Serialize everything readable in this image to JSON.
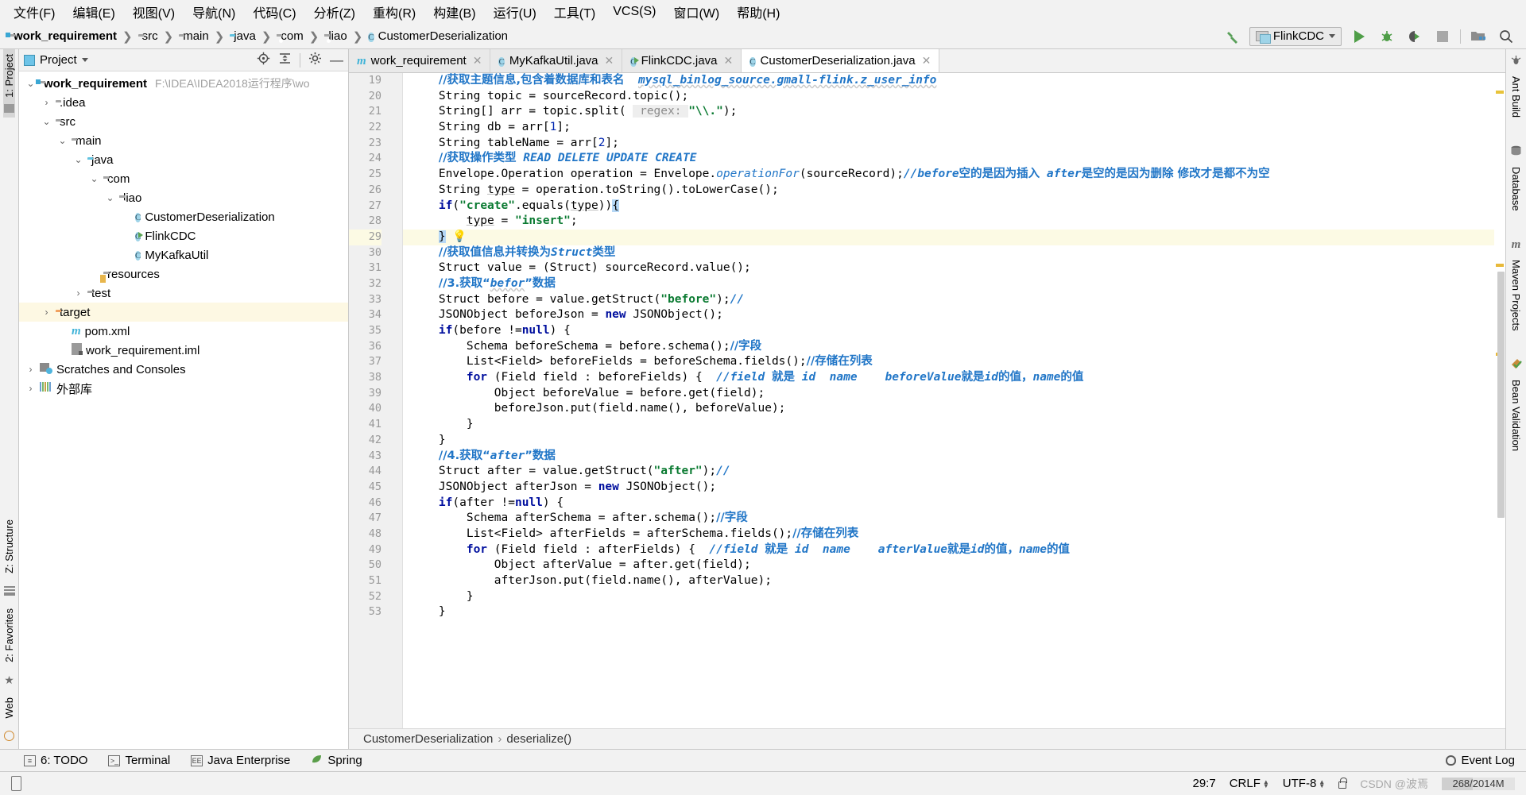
{
  "menubar": [
    {
      "label": "文件(F)"
    },
    {
      "label": "编辑(E)"
    },
    {
      "label": "视图(V)"
    },
    {
      "label": "导航(N)"
    },
    {
      "label": "代码(C)"
    },
    {
      "label": "分析(Z)"
    },
    {
      "label": "重构(R)"
    },
    {
      "label": "构建(B)"
    },
    {
      "label": "运行(U)"
    },
    {
      "label": "工具(T)"
    },
    {
      "label": "VCS(S)"
    },
    {
      "label": "窗口(W)"
    },
    {
      "label": "帮助(H)"
    }
  ],
  "breadcrumb": [
    {
      "label": "work_requirement",
      "icon": "module-folder-icon"
    },
    {
      "label": "src",
      "icon": "folder-icon"
    },
    {
      "label": "main",
      "icon": "folder-icon"
    },
    {
      "label": "java",
      "icon": "source-folder-icon"
    },
    {
      "label": "com",
      "icon": "package-icon"
    },
    {
      "label": "liao",
      "icon": "package-icon"
    },
    {
      "label": "CustomerDeserialization",
      "icon": "class-icon"
    }
  ],
  "toolbar": {
    "build_label": "build-hammer",
    "run_config": "FlinkCDC",
    "run_label": "run",
    "debug_label": "debug",
    "coverage_label": "run-with-coverage",
    "stop_label": "stop",
    "structure_label": "project-structure",
    "search_label": "search-everywhere"
  },
  "left_rail": {
    "top": "1: Project",
    "bottom": [
      "Z: Structure",
      "2: Favorites",
      "Web"
    ]
  },
  "right_rail": [
    "Ant Build",
    "Database",
    "Maven Projects",
    "Bean Validation"
  ],
  "project_panel": {
    "title": "Project",
    "tree": [
      {
        "indent": 0,
        "arrow": "v",
        "icon": "module-folder-icon",
        "label": "work_requirement",
        "bold": true,
        "path": "F:\\IDEA\\IDEA2018运行程序\\wo",
        "selected": false
      },
      {
        "indent": 1,
        "arrow": ">",
        "icon": "folder-icon",
        "label": ".idea",
        "bold": false,
        "path": "",
        "selected": false
      },
      {
        "indent": 1,
        "arrow": "v",
        "icon": "folder-icon",
        "label": "src",
        "bold": false,
        "path": "",
        "selected": false
      },
      {
        "indent": 2,
        "arrow": "v",
        "icon": "folder-icon",
        "label": "main",
        "bold": false,
        "path": "",
        "selected": false
      },
      {
        "indent": 3,
        "arrow": "v",
        "icon": "source-folder-icon",
        "label": "java",
        "bold": false,
        "path": "",
        "selected": false
      },
      {
        "indent": 4,
        "arrow": "v",
        "icon": "package-icon",
        "label": "com",
        "bold": false,
        "path": "",
        "selected": false
      },
      {
        "indent": 5,
        "arrow": "v",
        "icon": "package-icon",
        "label": "liao",
        "bold": false,
        "path": "",
        "selected": false
      },
      {
        "indent": 6,
        "arrow": "",
        "icon": "class-icon",
        "label": "CustomerDeserialization",
        "bold": false,
        "path": "",
        "selected": false
      },
      {
        "indent": 6,
        "arrow": "",
        "icon": "runnable-class-icon",
        "label": "FlinkCDC",
        "bold": false,
        "path": "",
        "selected": false
      },
      {
        "indent": 6,
        "arrow": "",
        "icon": "class-icon",
        "label": "MyKafkaUtil",
        "bold": false,
        "path": "",
        "selected": false
      },
      {
        "indent": 4,
        "arrow": "",
        "icon": "resources-folder-icon",
        "label": "resources",
        "bold": false,
        "path": "",
        "selected": false
      },
      {
        "indent": 3,
        "arrow": ">",
        "icon": "folder-icon",
        "label": "test",
        "bold": false,
        "path": "",
        "selected": false
      },
      {
        "indent": 1,
        "arrow": ">",
        "icon": "target-folder-icon",
        "label": "target",
        "bold": false,
        "path": "",
        "selected": true
      },
      {
        "indent": 2,
        "arrow": "",
        "icon": "maven-icon",
        "label": "pom.xml",
        "bold": false,
        "path": "",
        "selected": false
      },
      {
        "indent": 2,
        "arrow": "",
        "icon": "iml-icon",
        "label": "work_requirement.iml",
        "bold": false,
        "path": "",
        "selected": false
      },
      {
        "indent": 0,
        "arrow": ">",
        "icon": "scratches-icon",
        "label": "Scratches and Consoles",
        "bold": false,
        "path": "",
        "selected": false
      },
      {
        "indent": 0,
        "arrow": ">",
        "icon": "external-libraries-icon",
        "label": "外部库",
        "bold": false,
        "path": "",
        "selected": false
      }
    ]
  },
  "tabs": [
    {
      "label": "work_requirement",
      "icon": "maven-icon",
      "active": false
    },
    {
      "label": "MyKafkaUtil.java",
      "icon": "class-icon",
      "active": false
    },
    {
      "label": "FlinkCDC.java",
      "icon": "runnable-class-icon",
      "active": false
    },
    {
      "label": "CustomerDeserialization.java",
      "icon": "class-icon",
      "active": true
    }
  ],
  "editor": {
    "first_line": 19,
    "lines": [
      {
        "n": 19,
        "html": "    <span class='cmz'>//获取主题信息,包含着数据库和表名</span>  <span class='cm wavy'>mysql_binlog_source.gmall-flink.z_user_info</span>"
      },
      {
        "n": 20,
        "html": "    String topic = sourceRecord.topic();"
      },
      {
        "n": 21,
        "html": "    String[] arr = topic.split( <span class='hint'> regex: </span><span class='str'>\"\\\\.\"</span>);"
      },
      {
        "n": 22,
        "html": "    String db = arr[<span class='num'>1</span>];"
      },
      {
        "n": 23,
        "html": "    String tableName = arr[<span class='num'>2</span>];"
      },
      {
        "n": 24,
        "html": "    <span class='cmz'>//获取操作类型</span> <span class='cm'>READ DELETE UPDATE CREATE</span>"
      },
      {
        "n": 25,
        "html": "    Envelope.Operation operation = Envelope.<span class='cm' style='font-weight:normal'>operationFor</span>(sourceRecord);<span class='cm'>//before</span><span class='cmz'>空的是因为插入</span> <span class='cm'>after</span><span class='cmz'>是空的是因为删除 修改才是都不为空</span>"
      },
      {
        "n": 26,
        "html": "    String <span class='ul'>type</span> = operation.toString().toLowerCase();"
      },
      {
        "n": 27,
        "html": "    <span class='kw'>if</span>(<span class='str'>\"create\"</span>.equals(<span class='ul'>type</span>))<span class='brkt'>{</span>"
      },
      {
        "n": 28,
        "html": "        <span class='ul'>type</span> = <span class='str'>\"insert\"</span>;"
      },
      {
        "n": 29,
        "html": "    <span class='brkt'>}</span>",
        "highlight": true,
        "bulb": true
      },
      {
        "n": 30,
        "html": "    <span class='cmz'>//获取值信息并转换为</span><span class='cm'>Struct</span><span class='cmz'>类型</span>"
      },
      {
        "n": 31,
        "html": "    Struct value = (Struct) sourceRecord.value();"
      },
      {
        "n": 32,
        "html": "    <span class='cmz'>//3.获取“</span><span class='cm wavy'>befor</span><span class='cmz'>”数据</span>"
      },
      {
        "n": 33,
        "html": "    Struct before = value.getStruct(<span class='str'>\"before\"</span>);<span class='cm'>//</span>"
      },
      {
        "n": 34,
        "html": "    JSONObject beforeJson = <span class='kw'>new</span> JSONObject();"
      },
      {
        "n": 35,
        "html": "    <span class='kw'>if</span>(before !=<span class='kw'>null</span>) {"
      },
      {
        "n": 36,
        "html": "        Schema beforeSchema = before.schema();<span class='cmz'>//字段</span>"
      },
      {
        "n": 37,
        "html": "        List&lt;Field&gt; beforeFields = beforeSchema.fields();<span class='cmz'>//存储在列表</span>"
      },
      {
        "n": 38,
        "html": "        <span class='kw'>for</span> (Field field : beforeFields) {  <span class='cm'>//field </span><span class='cmz'>就是</span><span class='cm'> id  name    beforeValue</span><span class='cmz'>就是</span><span class='cm'>id</span><span class='cmz'>的值，</span><span class='cm'>name</span><span class='cmz'>的值</span>"
      },
      {
        "n": 39,
        "html": "            Object beforeValue = before.get(field);"
      },
      {
        "n": 40,
        "html": "            beforeJson.put(field.name(), beforeValue);"
      },
      {
        "n": 41,
        "html": "        }"
      },
      {
        "n": 42,
        "html": "    }"
      },
      {
        "n": 43,
        "html": "    <span class='cmz'>//4.获取“</span><span class='cm'>after</span><span class='cmz'>”数据</span>"
      },
      {
        "n": 44,
        "html": "    Struct after = value.getStruct(<span class='str'>\"after\"</span>);<span class='cm'>//</span>"
      },
      {
        "n": 45,
        "html": "    JSONObject afterJson = <span class='kw'>new</span> JSONObject();"
      },
      {
        "n": 46,
        "html": "    <span class='kw'>if</span>(after !=<span class='kw'>null</span>) {"
      },
      {
        "n": 47,
        "html": "        Schema afterSchema = after.schema();<span class='cmz'>//字段</span>"
      },
      {
        "n": 48,
        "html": "        List&lt;Field&gt; afterFields = afterSchema.fields();<span class='cmz'>//存储在列表</span>"
      },
      {
        "n": 49,
        "html": "        <span class='kw'>for</span> (Field field : afterFields) {  <span class='cm'>//field </span><span class='cmz'>就是</span><span class='cm'> id  name    afterValue</span><span class='cmz'>就是</span><span class='cm'>id</span><span class='cmz'>的值，</span><span class='cm'>name</span><span class='cmz'>的值</span>"
      },
      {
        "n": 50,
        "html": "            Object afterValue = after.get(field);"
      },
      {
        "n": 51,
        "html": "            afterJson.put(field.name(), afterValue);"
      },
      {
        "n": 52,
        "html": "        }"
      },
      {
        "n": 53,
        "html": "    }"
      }
    ]
  },
  "bottom_breadcrumb": {
    "class": "CustomerDeserialization",
    "method": "deserialize()"
  },
  "toolwindow_bar": [
    {
      "label": "6: TODO",
      "icon": "todo-icon"
    },
    {
      "label": "Terminal",
      "icon": "terminal-icon"
    },
    {
      "label": "Java Enterprise",
      "icon": "java-enterprise-icon"
    },
    {
      "label": "Spring",
      "icon": "spring-leaf-icon"
    }
  ],
  "event_log": "Event Log",
  "statusbar": {
    "caret": "29:7",
    "line_sep": "CRLF",
    "encoding": "UTF-8",
    "lock": "read-only-toggle",
    "memory": "268/2014M",
    "watermark": "CSDN @波焉"
  },
  "colors": {
    "accent_blue": "#2176c7",
    "keyword_blue": "#000f9e",
    "string_green": "#0a7a31",
    "selection": "#c5dffb",
    "highlight_row": "#fcfae4",
    "panel_bg": "#f2f2f2"
  }
}
